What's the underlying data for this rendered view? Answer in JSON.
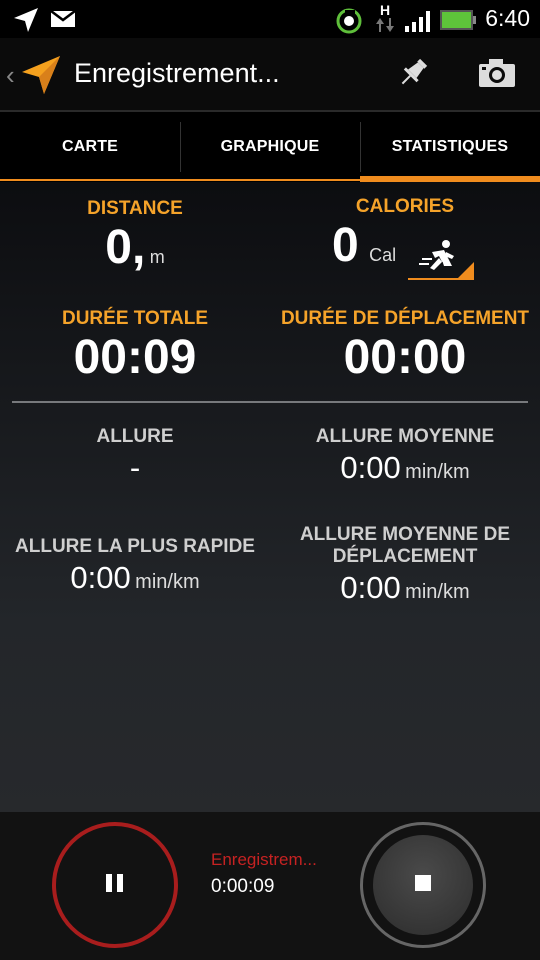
{
  "status_bar": {
    "time": "6:40",
    "network_label": "H",
    "icons": [
      "navigation-arrow-icon",
      "mail-icon",
      "sync-icon",
      "network-h-icon",
      "signal-icon",
      "battery-icon"
    ]
  },
  "action_bar": {
    "title": "Enregistrement...",
    "actions": [
      "pin-icon",
      "camera-icon"
    ]
  },
  "tabs": [
    {
      "label": "CARTE",
      "active": false
    },
    {
      "label": "GRAPHIQUE",
      "active": false
    },
    {
      "label": "STATISTIQUES",
      "active": true
    }
  ],
  "stats": {
    "distance": {
      "label": "DISTANCE",
      "value": "0,",
      "unit": "m"
    },
    "calories": {
      "label": "CALORIES",
      "value": "0",
      "unit": "Cal",
      "activity_icon": "running-icon"
    },
    "total_duration": {
      "label": "DURÉE TOTALE",
      "value": "00:09"
    },
    "moving_duration": {
      "label": "DURÉE DE DÉPLACEMENT",
      "value": "00:00"
    },
    "pace": {
      "label": "ALLURE",
      "value": "-"
    },
    "avg_pace": {
      "label": "ALLURE MOYENNE",
      "value": "0:00",
      "unit": "min/km"
    },
    "fastest_pace": {
      "label": "ALLURE LA PLUS RAPIDE",
      "value": "0:00",
      "unit": "min/km"
    },
    "avg_moving_pace": {
      "label_line1": "ALLURE MOYENNE DE",
      "label_line2": "DÉPLACEMENT",
      "value": "0:00",
      "unit": "min/km"
    }
  },
  "recording": {
    "status_label": "Enregistrem...",
    "elapsed": "0:00:09"
  },
  "colors": {
    "accent": "#f08c1e",
    "label_orange": "#f5a32a",
    "record_red": "#a81d1d"
  }
}
